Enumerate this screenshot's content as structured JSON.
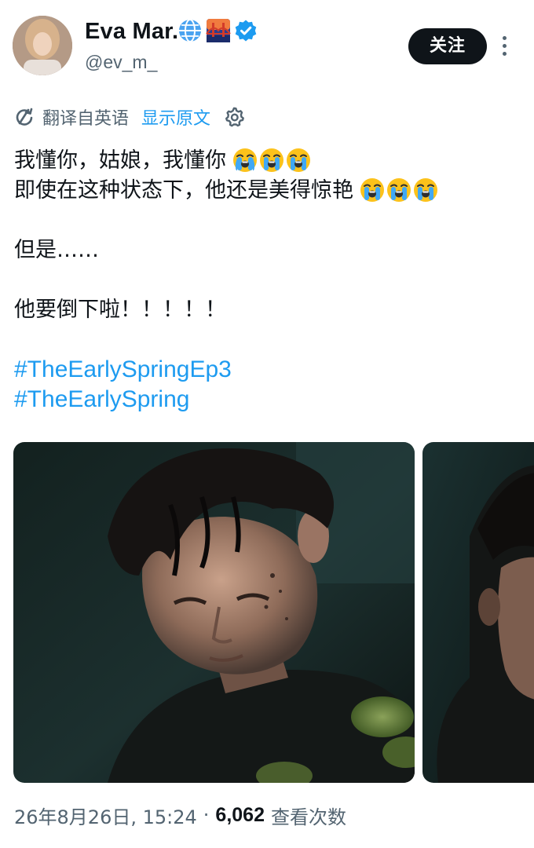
{
  "author": {
    "display_name": "Eva Mar.",
    "handle": "@ev_m_",
    "badges": [
      "globe-icon",
      "bridge-emoji-icon",
      "verified-badge-icon"
    ],
    "verified_color": "#1d9bf0"
  },
  "actions": {
    "follow_label": "关注",
    "more_icon": "more-vertical-icon"
  },
  "translation": {
    "label": "翻译自英语",
    "show_original": "显示原文",
    "icon": "translate-icon",
    "settings_icon": "gear-icon"
  },
  "tweet": {
    "lines": [
      "我懂你，姑娘，我懂你",
      "即使在这种状态下，他还是美得惊艳",
      "但是……",
      "他要倒下啦！！！！！"
    ],
    "emoji": "loudly-crying-face",
    "hashtags": [
      "#TheEarlySpringEp3",
      "#TheEarlySpring"
    ]
  },
  "media": {
    "count_visible": 2
  },
  "meta": {
    "date_time": "26年8月26日, 15:24",
    "separator": "·",
    "views_count": "6,062",
    "views_label": "查看次数"
  },
  "colors": {
    "text": "#0f1419",
    "secondary": "#536471",
    "link": "#1d9bf0"
  }
}
